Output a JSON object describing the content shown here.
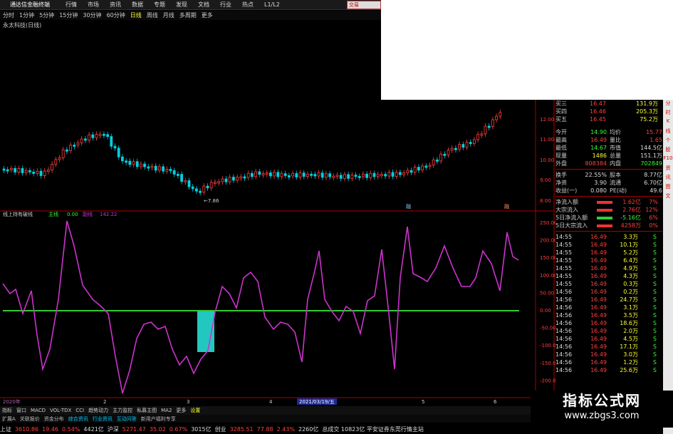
{
  "app": {
    "title": "通达信金融终端"
  },
  "menu": [
    "行情",
    "市场",
    "资讯",
    "数据",
    "专题",
    "发现",
    "文档",
    "行业",
    "热点",
    "L1/L2"
  ],
  "top_right": "交易",
  "periods": [
    "分时",
    "1分钟",
    "5分钟",
    "15分钟",
    "30分钟",
    "60分钟",
    "日线",
    "周线",
    "月线",
    "多周期",
    "更多"
  ],
  "active_period": "日线",
  "stock_title": "永太科技(日线)",
  "kline": {
    "low_label": "←7.86",
    "markers": [
      "融",
      "融"
    ]
  },
  "price_axis": [
    "12.00",
    "11.00",
    "10.00",
    "9.00",
    "8.00"
  ],
  "indicator": {
    "name": "线上持有破线",
    "series": [
      {
        "label": "主线",
        "value": "0.00",
        "color": "#3f3"
      },
      {
        "label": "副线",
        "value": "142.22",
        "color": "#c3c"
      }
    ],
    "yaxis": [
      "250.00",
      "200.00",
      "150.00",
      "100.00",
      "50.00",
      "0.00",
      "-50.00",
      "-100.00",
      "-150.00",
      "-200.00"
    ]
  },
  "date_axis": {
    "left": "2020年",
    "date": "2021/03/19/五",
    "ticks": [
      "2",
      "3",
      "4",
      "5",
      "6"
    ]
  },
  "bottom_tabs": [
    "指标",
    "窗口",
    "MACD",
    "VOL-TDX",
    "CCI",
    "趋势动力",
    "主力监控",
    "私募主图",
    "MA2",
    "更多",
    "设置"
  ],
  "bottom_tabs_active": "设置",
  "bottom_tabs2": [
    "扩展A",
    "关联报价",
    "资金分布",
    "综合资讯",
    "行业资讯",
    "互动问答",
    "新用户福利专享"
  ],
  "status": [
    {
      "name": "上证",
      "price": "3610.86",
      "chg": "19.46",
      "pct": "0.54%",
      "amt": "4421亿"
    },
    {
      "name": "沪深",
      "price": "5271.47",
      "chg": "35.02",
      "pct": "0.67%",
      "amt": "3015亿"
    },
    {
      "name": "创业",
      "price": "3285.51",
      "chg": "77.88",
      "pct": "2.43%",
      "amt": "2260亿"
    }
  ],
  "status_tail": "总成交 10823亿 平安证券东莞行情主站",
  "quote": {
    "order": [
      {
        "l": "买三",
        "p": "16.47",
        "v": "131.9万"
      },
      {
        "l": "买四",
        "p": "16.46",
        "v": "205.3万"
      },
      {
        "l": "买五",
        "p": "16.45",
        "v": "75.2万"
      }
    ],
    "stats": [
      {
        "a": "今开",
        "b": "14.90",
        "c": "均价",
        "d": "15.77"
      },
      {
        "a": "最高",
        "b": "16.49",
        "c": "量比",
        "d": "1.65"
      },
      {
        "a": "最低",
        "b": "14.67",
        "c": "市值",
        "d": "144.5亿"
      },
      {
        "a": "现量",
        "b": "1486",
        "c": "总量",
        "d": "151.1万"
      },
      {
        "a": "外盘",
        "b": "808384",
        "c": "内盘",
        "d": "702849"
      },
      {
        "a": "换手",
        "b": "22.55%",
        "c": "股本",
        "d": "8.77亿"
      },
      {
        "a": "净资",
        "b": "3.90",
        "c": "流通",
        "d": "6.70亿"
      },
      {
        "a": "收益(一)",
        "b": "0.080",
        "c": "PE(动)",
        "d": "49.6"
      }
    ],
    "flows": [
      {
        "l": "净流入额",
        "v": "1.62亿",
        "p": "7%"
      },
      {
        "l": "大宗流入",
        "v": "2.76亿",
        "p": "12%"
      },
      {
        "l": "5日净流入额",
        "v": "-5.16亿",
        "p": "6%"
      },
      {
        "l": "5日大宗流入",
        "v": "4258万",
        "p": "0%"
      }
    ],
    "ticks": [
      {
        "t": "14:55",
        "p": "16.49",
        "v": "3.3万",
        "s": "S"
      },
      {
        "t": "14:55",
        "p": "16.49",
        "v": "10.1万",
        "s": "S"
      },
      {
        "t": "14:55",
        "p": "16.49",
        "v": "5.2万",
        "s": "S"
      },
      {
        "t": "14:55",
        "p": "16.49",
        "v": "6.4万",
        "s": "S"
      },
      {
        "t": "14:55",
        "p": "16.49",
        "v": "4.9万",
        "s": "S"
      },
      {
        "t": "14:55",
        "p": "16.49",
        "v": "4.3万",
        "s": "S"
      },
      {
        "t": "14:55",
        "p": "16.49",
        "v": "0.3万",
        "s": "S"
      },
      {
        "t": "14:56",
        "p": "16.49",
        "v": "0.2万",
        "s": "S"
      },
      {
        "t": "14:56",
        "p": "16.49",
        "v": "24.7万",
        "s": "S"
      },
      {
        "t": "14:56",
        "p": "16.49",
        "v": "3.1万",
        "s": "S"
      },
      {
        "t": "14:56",
        "p": "16.49",
        "v": "3.5万",
        "s": "S"
      },
      {
        "t": "14:56",
        "p": "16.49",
        "v": "18.6万",
        "s": "S"
      },
      {
        "t": "14:56",
        "p": "16.49",
        "v": "2.0万",
        "s": "S"
      },
      {
        "t": "14:56",
        "p": "16.49",
        "v": "4.5万",
        "s": "S"
      },
      {
        "t": "14:56",
        "p": "16.49",
        "v": "17.1万",
        "s": "S"
      },
      {
        "t": "14:56",
        "p": "16.49",
        "v": "3.0万",
        "s": "S"
      },
      {
        "t": "14:56",
        "p": "16.49",
        "v": "1.2万",
        "s": "S"
      },
      {
        "t": "14:56",
        "p": "16.49",
        "v": "25.6万",
        "s": "S"
      }
    ]
  },
  "sidebar": [
    "分",
    "时",
    "K",
    "线",
    "个",
    "股",
    "F10",
    "资",
    "讯",
    "图",
    "文"
  ],
  "watermark": {
    "title": "指标公式网",
    "url": "www.zbgs3.com"
  },
  "colors": {
    "up": "#ff4040",
    "down": "#00d0e0",
    "line": "#cc33cc",
    "zero": "#33cc33",
    "fill": "#22c8c0"
  }
}
